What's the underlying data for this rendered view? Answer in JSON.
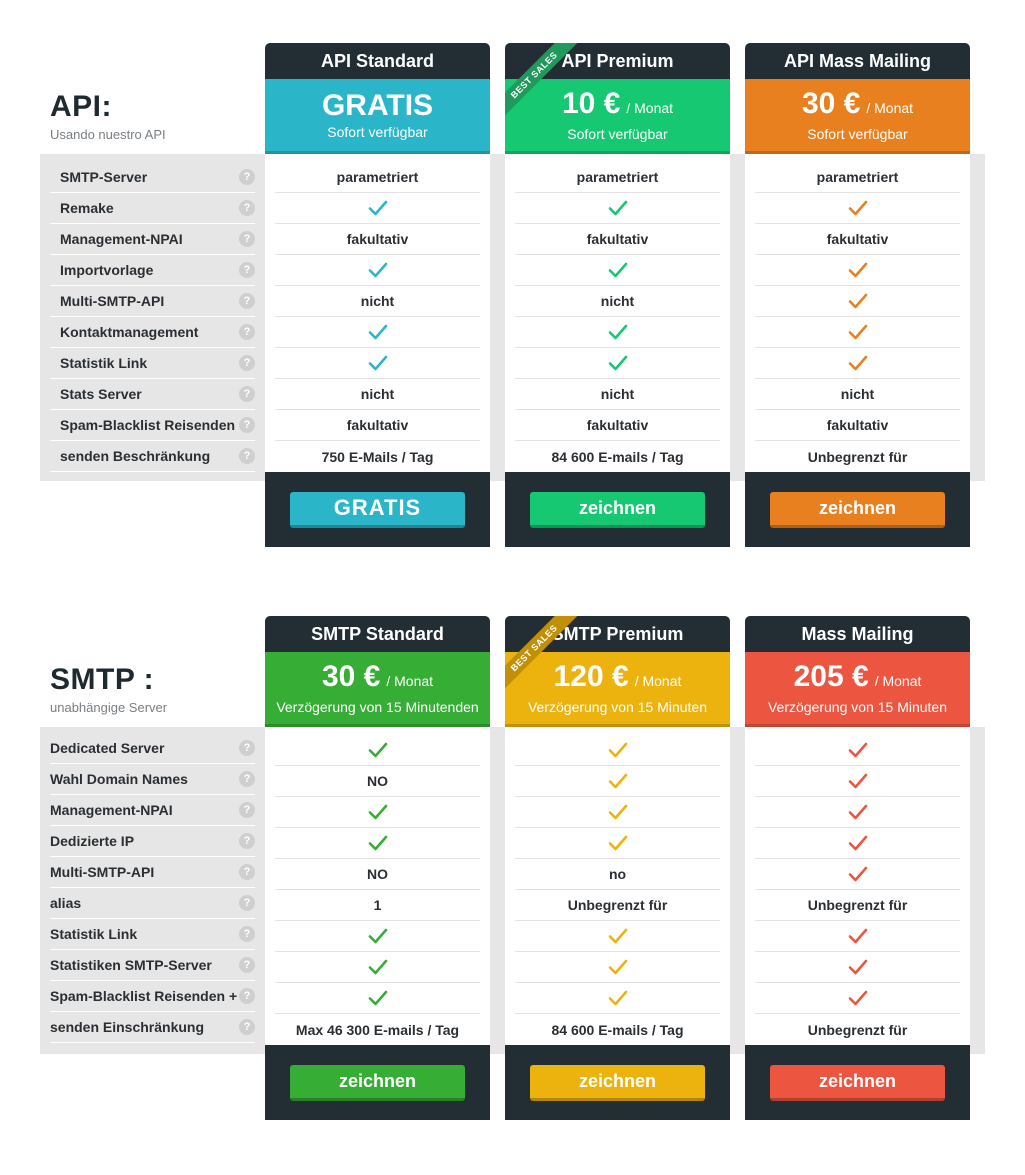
{
  "api": {
    "title": "API:",
    "subtitle": "Usando nuestro API",
    "features": [
      "SMTP-Server",
      "Remake",
      "Management-NPAI",
      "Importvorlage",
      "Multi-SMTP-API",
      "Kontaktmanagement",
      "Statistik Link",
      "Stats Server",
      "Spam-Blacklist Reisenden",
      "senden Beschränkung"
    ],
    "help_glyph": "?",
    "plans": [
      {
        "name": "API Standard",
        "price": "GRATIS",
        "unit": "",
        "note": "Sofort verfügbar",
        "badge": "",
        "color": "#2ab6c8",
        "cells": [
          "parametriert",
          "check",
          "fakultativ",
          "check",
          "nicht",
          "check",
          "check",
          "nicht",
          "fakultativ",
          "750 E-Mails / Tag"
        ],
        "button": "GRATIS"
      },
      {
        "name": "API Premium",
        "price": "10 €",
        "unit": "/ Monat",
        "note": "Sofort verfügbar",
        "badge": "BEST SALES",
        "color": "#16c871",
        "cells": [
          "parametriert",
          "check",
          "fakultativ",
          "check",
          "nicht",
          "check",
          "check",
          "nicht",
          "fakultativ",
          "84 600 E-mails / Tag"
        ],
        "button": "zeichnen"
      },
      {
        "name": "API Mass Mailing",
        "price": "30 €",
        "unit": "/ Monat",
        "note": "Sofort verfügbar",
        "badge": "",
        "color": "#e8801f",
        "cells": [
          "parametriert",
          "check",
          "fakultativ",
          "check",
          "check",
          "check",
          "check",
          "nicht",
          "fakultativ",
          "Unbegrenzt für"
        ],
        "button": "zeichnen"
      }
    ]
  },
  "smtp": {
    "title": "SMTP :",
    "subtitle": "unabhängige Server",
    "features": [
      "Dedicated Server",
      "Wahl Domain Names",
      "Management-NPAI",
      "Dedizierte IP",
      "Multi-SMTP-API",
      "alias",
      "Statistik Link",
      "Statistiken SMTP-Server",
      "Spam-Blacklist Reisenden +",
      "senden Einschränkung"
    ],
    "help_glyph": "?",
    "plans": [
      {
        "name": "SMTP Standard",
        "price": "30 €",
        "unit": "/ Monat",
        "note": "Verzögerung von 15 Minutenden",
        "badge": "",
        "color": "#36ad35",
        "cells": [
          "check",
          "NO",
          "check",
          "check",
          "NO",
          "1",
          "check",
          "check",
          "check",
          "Max 46 300 E-mails / Tag"
        ],
        "button": "zeichnen"
      },
      {
        "name": "SMTP Premium",
        "price": "120 €",
        "unit": "/ Monat",
        "note": "Verzögerung von 15 Minuten",
        "badge": "BEST SALES",
        "color": "#ecb30f",
        "cells": [
          "check",
          "check",
          "check",
          "check",
          "no",
          "Unbegrenzt für",
          "check",
          "check",
          "check",
          "84 600  E-mails / Tag"
        ],
        "button": "zeichnen"
      },
      {
        "name": "Mass Mailing",
        "price": "205 €",
        "unit": "/ Monat",
        "note": "Verzögerung von 15 Minuten",
        "badge": "",
        "color": "#ec5640",
        "cells": [
          "check",
          "check",
          "check",
          "check",
          "check",
          "Unbegrenzt für",
          "check",
          "check",
          "check",
          "Unbegrenzt für"
        ],
        "button": "zeichnen"
      }
    ]
  },
  "ribbon_color": "#1f9a5c",
  "ribbon_color_gold": "#c28f08"
}
